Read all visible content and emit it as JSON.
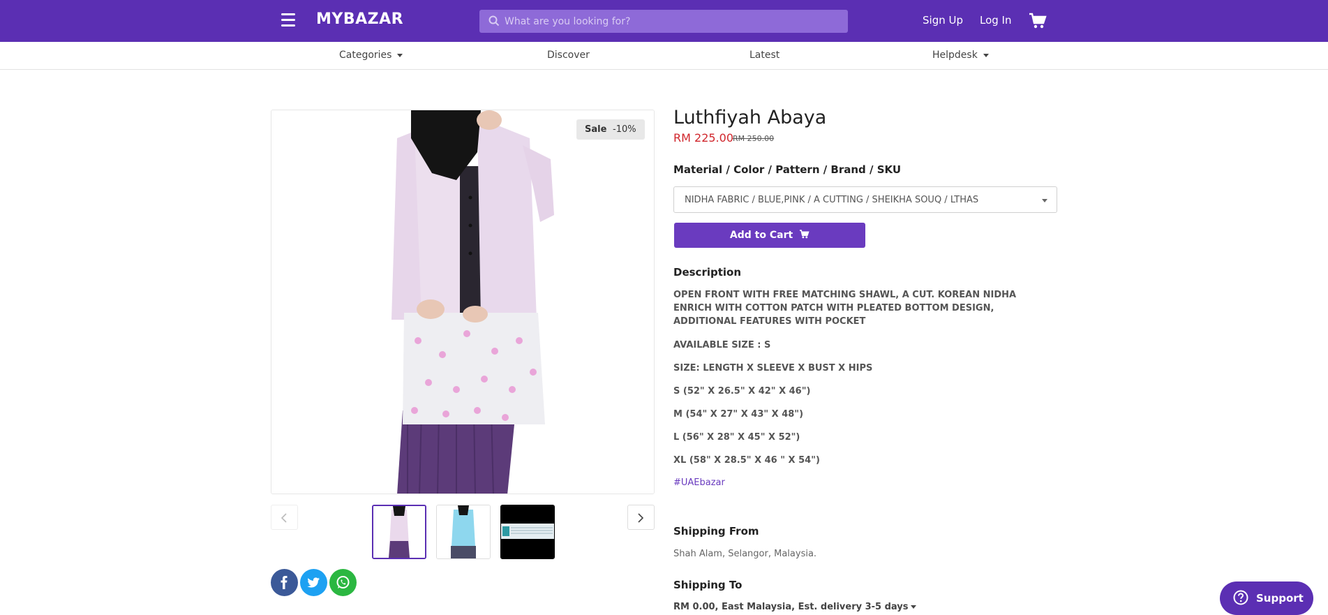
{
  "header": {
    "logo": "MYBAZAR",
    "search_placeholder": "What are you looking for?",
    "signup": "Sign Up",
    "login": "Log In"
  },
  "subnav": {
    "categories": "Categories",
    "discover": "Discover",
    "latest": "Latest",
    "helpdesk": "Helpdesk"
  },
  "gallery": {
    "sale_label": "Sale",
    "discount": "-10%"
  },
  "product": {
    "title": "Luthfiyah Abaya",
    "price": "RM 225.00",
    "old_price": "RM 250.00",
    "option_label": "Material / Color / Pattern / Brand / SKU",
    "option_value": "NIDHA FABRIC / BLUE,PINK / A CUTTING / SHEIKHA SOUQ / LTHAS",
    "add_to_cart": "Add to Cart"
  },
  "description": {
    "heading": "Description",
    "line1": "OPEN FRONT WITH FREE MATCHING SHAWL, A CUT. KOREAN NIDHA ENRICH WITH COTTON PATCH WITH PLEATED BOTTOM DESIGN, ADDITIONAL FEATURES WITH POCKET",
    "available": "AVAILABLE SIZE : S",
    "size_header": "SIZE: LENGTH X SLEEVE X BUST X HIPS",
    "size_s": "S (52\" X 26.5\" X 42\" X 46\")",
    "size_m": "M (54\" X 27\" X 43\" X 48\")",
    "size_l": "L (56\" X 28\" X 45\" X 52\")",
    "size_xl": "XL (58\" X 28.5\" X 46 \" X 54\")",
    "hashtag": "#UAEbazar"
  },
  "shipping": {
    "from_heading": "Shipping From",
    "from_value": "Shah Alam, Selangor, Malaysia.",
    "to_heading": "Shipping To",
    "to_value": "RM 0.00, East Malaysia, Est. delivery 3-5 days"
  },
  "support": {
    "label": "Support"
  }
}
